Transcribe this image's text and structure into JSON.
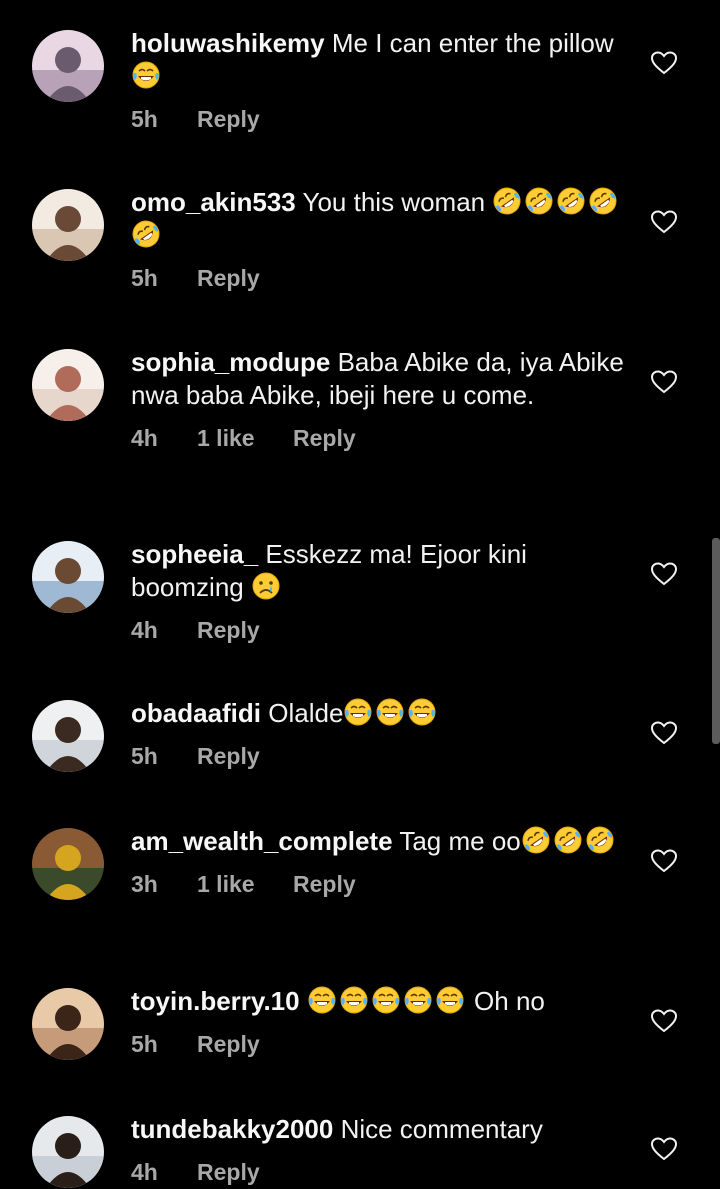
{
  "colors": {
    "background": "#000000",
    "text": "#f2f2f2",
    "meta": "#a8a8a8"
  },
  "comments": [
    {
      "username": "holuwashikemy",
      "text_before": "Me I can enter the pillow",
      "emojis": [
        "laugh-tears"
      ],
      "text_after": "",
      "time": "5h",
      "likes": "",
      "reply": "Reply",
      "avatar": "avatar-1"
    },
    {
      "username": "omo_akin533",
      "text_before": "You this woman ",
      "emojis": [
        "rofl",
        "rofl",
        "rofl",
        "rofl",
        "rofl"
      ],
      "text_after": "",
      "time": "5h",
      "likes": "",
      "reply": "Reply",
      "avatar": "avatar-2"
    },
    {
      "username": "sophia_modupe",
      "text_before": "Baba Abike da, iya Abike nwa baba Abike, ibeji here u come.",
      "emojis": [],
      "text_after": "",
      "time": "4h",
      "likes": "1 like",
      "reply": "Reply",
      "avatar": "avatar-3"
    },
    {
      "username": "sopheeia_",
      "text_before": "Esskezz ma! Ejoor kini boomzing ",
      "emojis": [
        "crying"
      ],
      "text_after": "",
      "time": "4h",
      "likes": "",
      "reply": "Reply",
      "avatar": "avatar-4"
    },
    {
      "username": "obadaafidi",
      "text_before": "Olalde",
      "emojis": [
        "laugh-tears",
        "laugh-tears",
        "laugh-tears"
      ],
      "text_after": "",
      "time": "5h",
      "likes": "",
      "reply": "Reply",
      "avatar": "avatar-5"
    },
    {
      "username": "am_wealth_complete",
      "text_before": "Tag me oo",
      "emojis": [
        "rofl",
        "rofl",
        "rofl"
      ],
      "text_after": "",
      "time": "3h",
      "likes": "1 like",
      "reply": "Reply",
      "avatar": "avatar-6"
    },
    {
      "username": "toyin.berry.10",
      "text_before": "",
      "emojis": [
        "laugh-tears",
        "laugh-tears",
        "laugh-tears",
        "laugh-tears",
        "laugh-tears"
      ],
      "text_after": " Oh no",
      "time": "5h",
      "likes": "",
      "reply": "Reply",
      "avatar": "avatar-7"
    },
    {
      "username": "tundebakky2000",
      "text_before": "Nice commentary",
      "emojis": [],
      "text_after": "",
      "time": "4h",
      "likes": "",
      "reply": "Reply",
      "avatar": "avatar-8"
    }
  ]
}
